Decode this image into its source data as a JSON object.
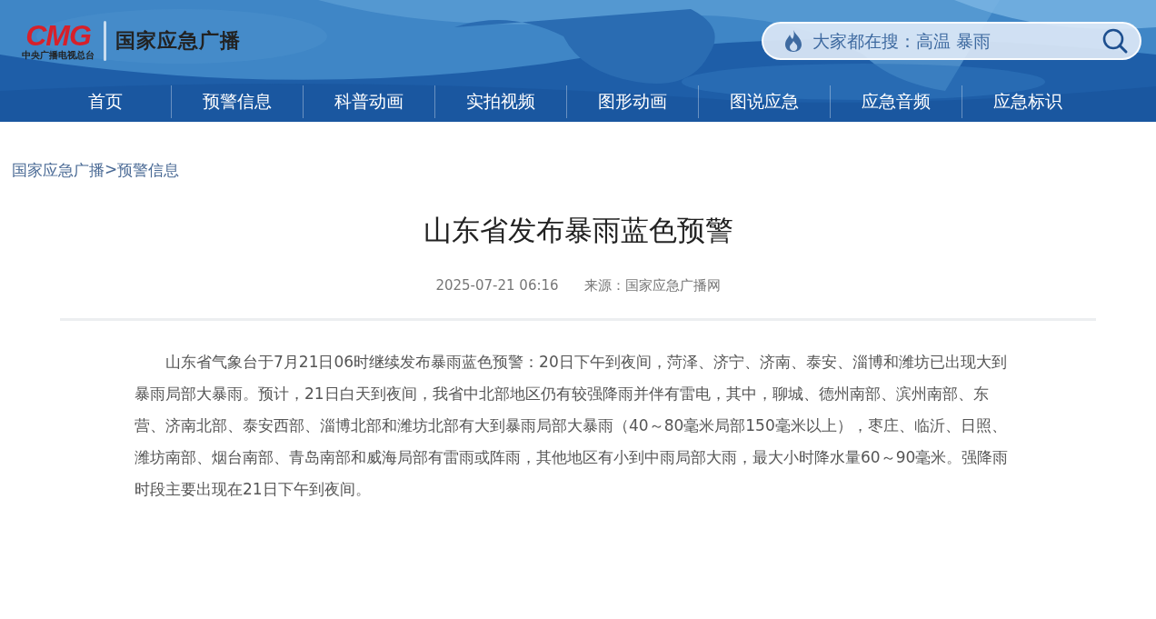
{
  "header": {
    "logo": {
      "mark": "CMG",
      "caption": "中央广播电视总台",
      "site_name": "国家应急广播"
    },
    "search": {
      "placeholder": "大家都在搜：高温 暴雨"
    }
  },
  "nav": [
    {
      "label": "首页"
    },
    {
      "label": "预警信息"
    },
    {
      "label": "科普动画"
    },
    {
      "label": "实拍视频"
    },
    {
      "label": "图形动画"
    },
    {
      "label": "图说应急"
    },
    {
      "label": "应急音频"
    },
    {
      "label": "应急标识"
    }
  ],
  "breadcrumb": {
    "items": [
      "国家应急广播",
      "预警信息"
    ],
    "separator": ">"
  },
  "article": {
    "title": "山东省发布暴雨蓝色预警",
    "date": "2025-07-21 06:16",
    "source": "来源：国家应急广播网",
    "paragraphs": [
      "山东省气象台于7月21日06时继续发布暴雨蓝色预警：20日下午到夜间，菏泽、济宁、济南、泰安、淄博和潍坊已出现大到暴雨局部大暴雨。预计，21日白天到夜间，我省中北部地区仍有较强降雨并伴有雷电，其中，聊城、德州南部、滨州南部、东营、济南北部、泰安西部、淄博北部和潍坊北部有大到暴雨局部大暴雨（40～80毫米局部150毫米以上），枣庄、临沂、日照、潍坊南部、烟台南部、青岛南部和威海局部有雷雨或阵雨，其他地区有小到中雨局部大雨，最大小时降水量60～90毫米。强降雨时段主要出现在21日下午到夜间。"
    ]
  }
}
